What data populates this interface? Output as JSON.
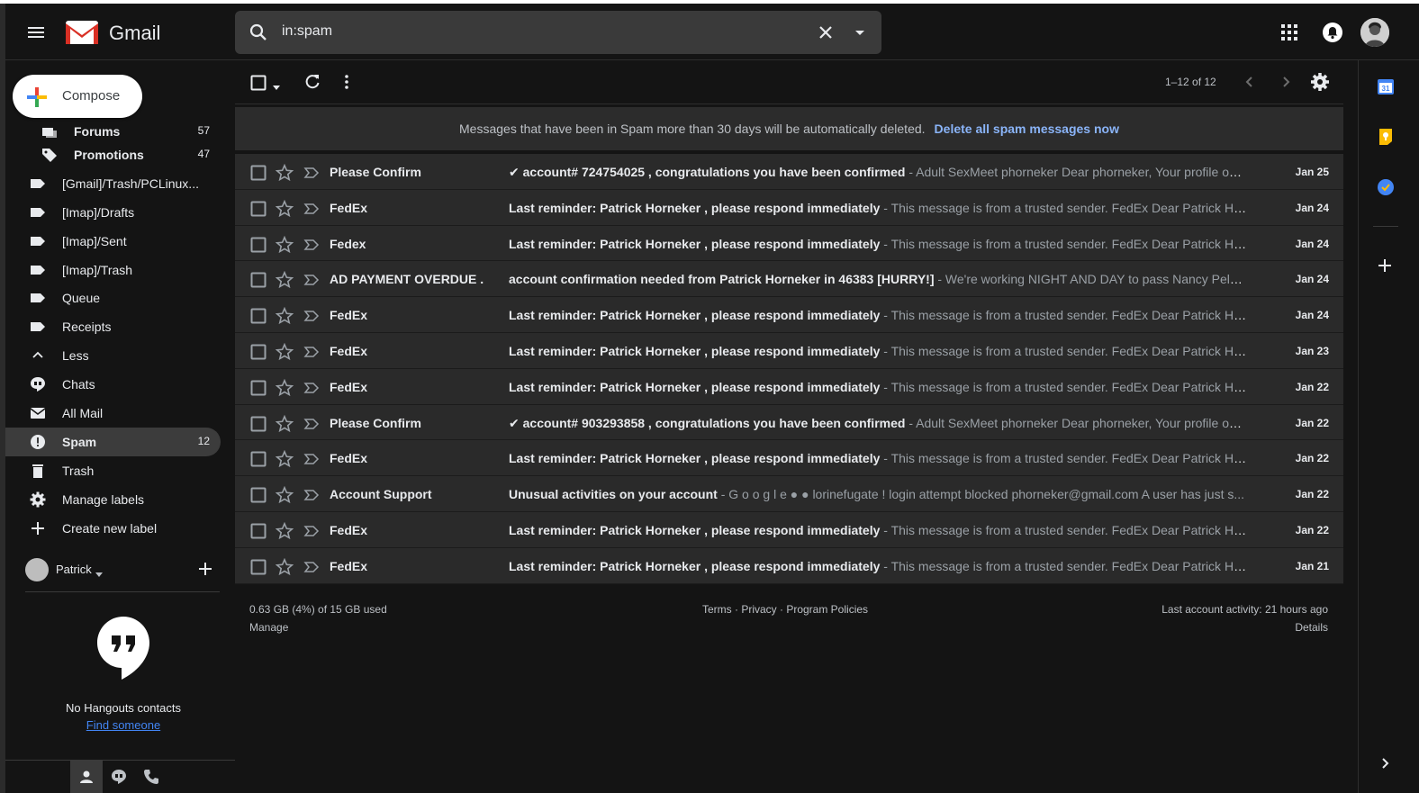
{
  "header": {
    "brand": "Gmail",
    "search_value": "in:spam"
  },
  "sidebar": {
    "compose_label": "Compose",
    "items": [
      {
        "label": "Forums",
        "count": "57",
        "icon": "forum-icon"
      },
      {
        "label": "Promotions",
        "count": "47",
        "icon": "tag-icon"
      },
      {
        "label": "[Gmail]/Trash/PCLinux...",
        "count": "",
        "icon": "label-icon"
      },
      {
        "label": "[Imap]/Drafts",
        "count": "",
        "icon": "label-icon"
      },
      {
        "label": "[Imap]/Sent",
        "count": "",
        "icon": "label-icon"
      },
      {
        "label": "[Imap]/Trash",
        "count": "",
        "icon": "label-icon"
      },
      {
        "label": "Queue",
        "count": "",
        "icon": "label-icon"
      },
      {
        "label": "Receipts",
        "count": "",
        "icon": "label-icon"
      },
      {
        "label": "Less",
        "count": "",
        "icon": "chevron-up-icon"
      },
      {
        "label": "Chats",
        "count": "",
        "icon": "chat-icon"
      },
      {
        "label": "All Mail",
        "count": "",
        "icon": "mail-icon"
      },
      {
        "label": "Spam",
        "count": "12",
        "icon": "spam-icon"
      },
      {
        "label": "Trash",
        "count": "",
        "icon": "trash-icon"
      },
      {
        "label": "Manage labels",
        "count": "",
        "icon": "gear-icon"
      },
      {
        "label": "Create new label",
        "count": "",
        "icon": "plus-icon"
      }
    ],
    "hangouts": {
      "user": "Patrick",
      "no_contacts": "No Hangouts contacts",
      "find_someone": "Find someone"
    }
  },
  "toolbar": {
    "pagination": "1–12 of 12"
  },
  "banner": {
    "text": "Messages that have been in Spam more than 30 days will be automatically deleted.",
    "link": "Delete all spam messages now"
  },
  "mails": [
    {
      "sender": "Please Confirm",
      "subject": "✔ account# 724754025 , congratulations you have been confirmed",
      "snippet": " - Adult SexMeet phorneker Dear phorneker, Your profile on ...",
      "date": "Jan 25"
    },
    {
      "sender": "FedEx",
      "subject": "Last reminder: Patrick Horneker , please respond immediately",
      "snippet": " - This message is from a trusted sender. FedEx Dear Patrick Ho...",
      "date": "Jan 24"
    },
    {
      "sender": "Fedex",
      "subject": "Last reminder: Patrick Horneker , please respond immediately",
      "snippet": " - This message is from a trusted sender. FedEx Dear Patrick Ho...",
      "date": "Jan 24"
    },
    {
      "sender": "AD PAYMENT OVERDUE .",
      "subject": "account confirmation needed from Patrick Horneker in 46383 [HURRY!]",
      "snippet": " - We're working NIGHT AND DAY to pass Nancy Pelosi'...",
      "date": "Jan 24"
    },
    {
      "sender": "FedEx",
      "subject": "Last reminder: Patrick Horneker , please respond immediately",
      "snippet": " - This message is from a trusted sender. FedEx Dear Patrick Ho...",
      "date": "Jan 24"
    },
    {
      "sender": "FedEx",
      "subject": "Last reminder: Patrick Horneker , please respond immediately",
      "snippet": " - This message is from a trusted sender. FedEx Dear Patrick Ho...",
      "date": "Jan 23"
    },
    {
      "sender": "FedEx",
      "subject": "Last reminder: Patrick Horneker , please respond immediately",
      "snippet": " - This message is from a trusted sender. FedEx Dear Patrick Ho...",
      "date": "Jan 22"
    },
    {
      "sender": "Please Confirm",
      "subject": "✔ account# 903293858 , congratulations you have been confirmed",
      "snippet": " - Adult SexMeet phorneker Dear phorneker, Your profile on ...",
      "date": "Jan 22"
    },
    {
      "sender": "FedEx",
      "subject": "Last reminder: Patrick Horneker , please respond immediately",
      "snippet": " - This message is from a trusted sender. FedEx Dear Patrick Ho...",
      "date": "Jan 22"
    },
    {
      "sender": "Account Support",
      "subject": "Unusual activities on your account",
      "snippet": " - G o o g l e ● ● lorinefugate ! login attempt blocked phorneker@gmail.com A user has just s...",
      "date": "Jan 22"
    },
    {
      "sender": "FedEx",
      "subject": "Last reminder: Patrick Horneker , please respond immediately",
      "snippet": " - This message is from a trusted sender. FedEx Dear Patrick Ho...",
      "date": "Jan 22"
    },
    {
      "sender": "FedEx",
      "subject": "Last reminder: Patrick Horneker , please respond immediately",
      "snippet": " - This message is from a trusted sender. FedEx Dear Patrick Ho...",
      "date": "Jan 21"
    }
  ],
  "footer": {
    "storage": "0.63 GB (4%) of 15 GB used",
    "manage": "Manage",
    "links": "Terms · Privacy · Program Policies",
    "activity": "Last account activity: 21 hours ago",
    "details": "Details"
  },
  "sidepanel": {
    "calendar_day": "31"
  }
}
